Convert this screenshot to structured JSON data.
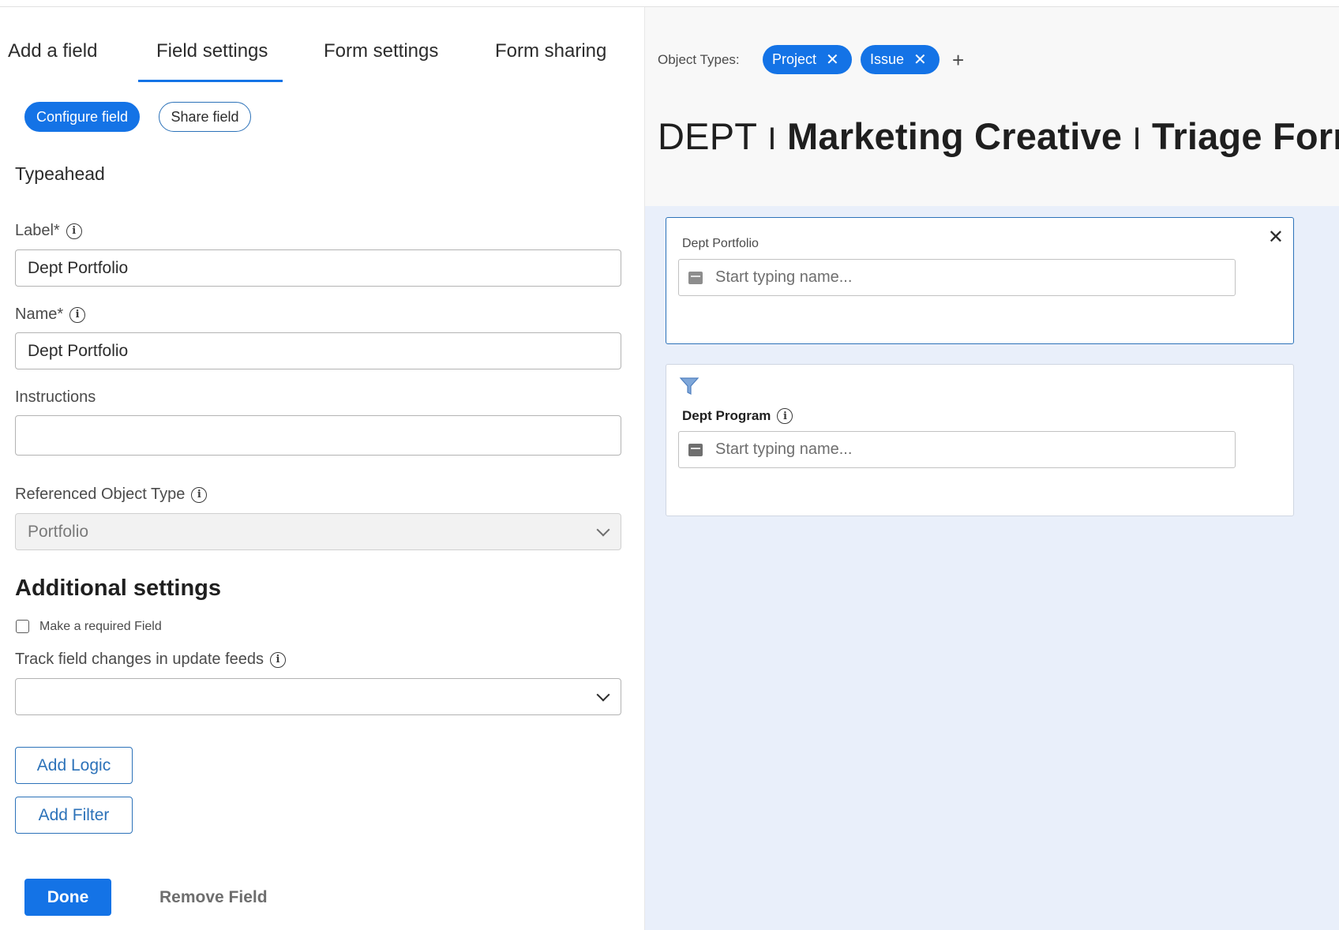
{
  "tabs": [
    {
      "label": "Add a field"
    },
    {
      "label": "Field settings",
      "active": true
    },
    {
      "label": "Form settings"
    },
    {
      "label": "Form sharing"
    }
  ],
  "sub_tabs": {
    "configure": "Configure field",
    "share": "Share field"
  },
  "field_type": "Typeahead",
  "fields": {
    "label": {
      "label": "Label*",
      "value": "Dept Portfolio"
    },
    "name": {
      "label": "Name*",
      "value": "Dept Portfolio"
    },
    "instructions": {
      "label": "Instructions",
      "value": ""
    },
    "ref_object_type": {
      "label": "Referenced Object Type",
      "value": "Portfolio"
    }
  },
  "additional": {
    "heading": "Additional settings",
    "required_label": "Make a required Field",
    "required_checked": false,
    "track_label": "Track field changes in update feeds",
    "track_value": ""
  },
  "buttons": {
    "add_logic": "Add Logic",
    "add_filter": "Add Filter",
    "done": "Done",
    "remove": "Remove Field"
  },
  "preview": {
    "object_types_label": "Object Types:",
    "object_types": [
      "Project",
      "Issue"
    ],
    "title_parts": [
      "DEPT",
      "Marketing Creative",
      "Triage Form"
    ],
    "title_separator": "I",
    "cards": [
      {
        "label": "Dept Portfolio",
        "placeholder": "Start typing name...",
        "icon": "portfolio-icon"
      },
      {
        "label": "Dept Program",
        "placeholder": "Start typing name...",
        "icon": "program-icon",
        "filter_icon": "filter-icon"
      }
    ]
  },
  "colors": {
    "accent": "#1473e6",
    "preview_bg": "#e9effa",
    "outline": "#2c72b9"
  }
}
